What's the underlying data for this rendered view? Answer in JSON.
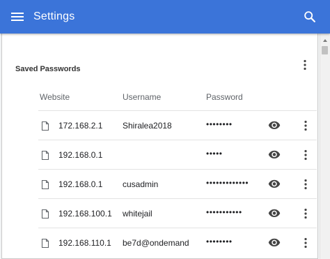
{
  "header": {
    "title": "Settings",
    "menu_icon": "hamburger-menu-icon",
    "search_icon": "search-icon",
    "background_color": "#3b74d9"
  },
  "section": {
    "title": "Saved Passwords",
    "more_icon": "more-vert-icon"
  },
  "table": {
    "columns": [
      "Website",
      "Username",
      "Password"
    ],
    "rows": [
      {
        "website": "172.168.2.1",
        "username": "Shiralea2018",
        "password": "••••••••"
      },
      {
        "website": "192.168.0.1",
        "username": "",
        "password": "•••••"
      },
      {
        "website": "192.168.0.1",
        "username": "cusadmin",
        "password": "•••••••••••••"
      },
      {
        "website": "192.168.100.1",
        "username": "whitejail",
        "password": "•••••••••••"
      },
      {
        "website": "192.168.110.1",
        "username": "be7d@ondemand",
        "password": "••••••••"
      }
    ],
    "row_icons": {
      "site": "file-icon",
      "show_password": "eye-icon",
      "actions": "more-vert-icon"
    }
  }
}
